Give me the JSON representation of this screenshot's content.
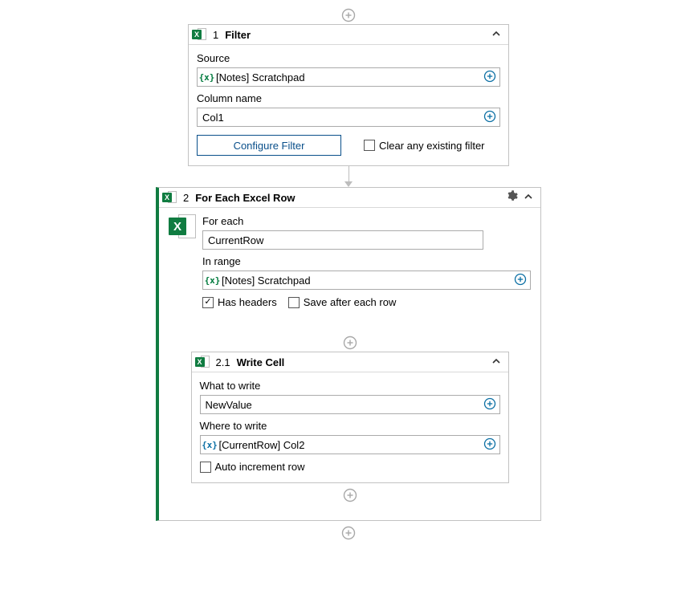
{
  "filter": {
    "num": "1",
    "title": "Filter",
    "source_label": "Source",
    "source_value": "[Notes] Scratchpad",
    "column_label": "Column name",
    "column_value": "Col1",
    "configure_btn": "Configure Filter",
    "clear_checkbox": "Clear any existing filter",
    "clear_checked": false
  },
  "foreach": {
    "num": "2",
    "title": "For Each Excel Row",
    "foreach_label": "For each",
    "foreach_value": "CurrentRow",
    "range_label": "In range",
    "range_value": "[Notes] Scratchpad",
    "has_headers_label": "Has headers",
    "has_headers_checked": true,
    "save_after_label": "Save after each row",
    "save_after_checked": false
  },
  "writecell": {
    "num": "2.1",
    "title": "Write Cell",
    "what_label": "What to write",
    "what_value": "NewValue",
    "where_label": "Where to write",
    "where_value": "[CurrentRow] Col2",
    "autoinc_label": "Auto increment row",
    "autoinc_checked": false
  }
}
